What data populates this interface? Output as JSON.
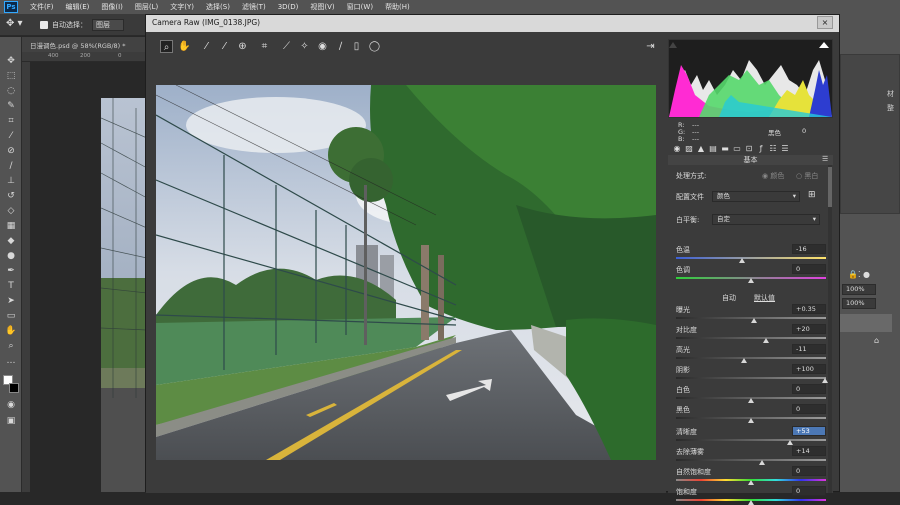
{
  "menubar": {
    "logo": "Ps",
    "items": [
      "文件(F)",
      "编辑(E)",
      "图像(I)",
      "图层(L)",
      "文字(Y)",
      "选择(S)",
      "滤镜(T)",
      "3D(D)",
      "视图(V)",
      "窗口(W)",
      "帮助(H)"
    ]
  },
  "options_bar": {
    "auto_select_label": "自动选择：",
    "auto_select_value": "图层"
  },
  "document": {
    "tab_title": "日漫调色.psd @ 58%(RGB/8) *",
    "ruler_ticks": [
      "400",
      "200",
      "0"
    ]
  },
  "right_panel": {
    "field_1": "100%",
    "field_2": "100%",
    "label_1": "材",
    "label_2": "整"
  },
  "camera_raw": {
    "title": "Camera Raw (IMG_0138.JPG)",
    "close": "×",
    "tools": [
      "zoom-tool-icon",
      "hand-tool-icon",
      "white-balance-icon",
      "color-sampler-icon",
      "target-adjust-icon",
      "crop-icon",
      "straighten-icon",
      "spot-removal-icon",
      "red-eye-icon",
      "adjustment-brush-icon",
      "graduated-filter-icon",
      "radial-filter-icon"
    ],
    "rgb": {
      "r_label": "R:",
      "g_label": "G:",
      "b_label": "B:",
      "r": "---",
      "g": "---",
      "b": "---",
      "mode": "黑色",
      "mode_value": "0"
    },
    "panel_title": "基本",
    "treatment_label": "处理方式:",
    "treatment_color": "颜色",
    "treatment_bw": "黑白",
    "profile_label": "配置文件",
    "profile_value": "颜色",
    "wb_label": "白平衡:",
    "wb_value": "自定",
    "auto_label": "自动",
    "default_label": "默认值",
    "sliders": [
      {
        "label": "色温",
        "value": "-16",
        "pos": 0.44,
        "track": "temp"
      },
      {
        "label": "色调",
        "value": "0",
        "pos": 0.5,
        "track": "tint"
      },
      {
        "label": "曝光",
        "value": "+0.35",
        "pos": 0.52,
        "track": "gray"
      },
      {
        "label": "对比度",
        "value": "+20",
        "pos": 0.6,
        "track": "gray"
      },
      {
        "label": "高光",
        "value": "-11",
        "pos": 0.45,
        "track": "gray"
      },
      {
        "label": "阴影",
        "value": "+100",
        "pos": 0.99,
        "track": "gray"
      },
      {
        "label": "白色",
        "value": "0",
        "pos": 0.5,
        "track": "gray"
      },
      {
        "label": "黑色",
        "value": "0",
        "pos": 0.5,
        "track": "gray"
      },
      {
        "label": "清晰度",
        "value": "+53",
        "pos": 0.76,
        "track": "gray",
        "highlight": true
      },
      {
        "label": "去除薄雾",
        "value": "+14",
        "pos": 0.57,
        "track": "gray"
      },
      {
        "label": "自然饱和度",
        "value": "0",
        "pos": 0.5,
        "track": "sat"
      },
      {
        "label": "饱和度",
        "value": "0",
        "pos": 0.5,
        "track": "sat"
      }
    ]
  }
}
